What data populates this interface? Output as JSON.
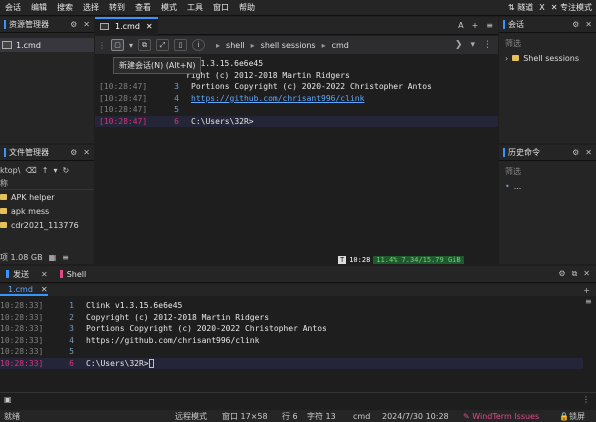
{
  "menu": [
    "会话",
    "编辑",
    "搜索",
    "选择",
    "转到",
    "查看",
    "模式",
    "工具",
    "窗口",
    "帮助"
  ],
  "menu_right": {
    "tunnel": "隧道",
    "x": "X",
    "focus": "专注模式"
  },
  "sessions_panel": {
    "title": "资源管理器",
    "item": "1.cmd"
  },
  "file_manager": {
    "title": "文件管理器",
    "path": "ktop\\",
    "col_name": "称",
    "files": [
      "APK helper",
      "apk mess",
      "cdr2021_113776"
    ],
    "status": "项 1.08 GB"
  },
  "main_tab": {
    "label": "1.cmd",
    "right": [
      "A",
      "+",
      "≡"
    ]
  },
  "breadcrumb": [
    "shell",
    "shell sessions",
    "cmd"
  ],
  "tooltip": "新建会话(N) (Alt+N)",
  "terminal_top": [
    {
      "ts": "",
      "ln": "",
      "text": "k v1.3.15.6e6e45",
      "hidden_ts": true
    },
    {
      "ts": "",
      "ln": "",
      "text": "right (c) 2012-2018 Martin Ridgers",
      "hidden_ts": true
    },
    {
      "ts": "[10:28:47]",
      "ln": "3",
      "text": "Portions Copyright (c) 2020-2022 Christopher Antos"
    },
    {
      "ts": "[10:28:47]",
      "ln": "4",
      "text": "https://github.com/chrisant996/clink",
      "link": true
    },
    {
      "ts": "[10:28:47]",
      "ln": "5",
      "text": ""
    },
    {
      "ts": "[10:28:47]",
      "ln": "6",
      "text": "C:\\Users\\32R>",
      "current": true
    }
  ],
  "main_status": {
    "time": "10:28",
    "cpu": "11.4%",
    "mem": "7.34/15.79 GiB"
  },
  "sessions_right": {
    "title": "会话",
    "item": "Shell sessions"
  },
  "history": {
    "title": "历史命令",
    "filter": "筛选",
    "item": "..."
  },
  "sessions_filter": "筛选",
  "bottom_tabs": {
    "send": "发送",
    "shell": "Shell"
  },
  "bottom_tab_label": "1.cmd",
  "terminal_bottom": [
    {
      "ts": "10:28:33]",
      "ln": "1",
      "text": "Clink v1.3.15.6e6e45"
    },
    {
      "ts": "10:28:33]",
      "ln": "2",
      "text": "Copyright (c) 2012-2018 Martin Ridgers"
    },
    {
      "ts": "10:28:33]",
      "ln": "3",
      "text": "Portions Copyright (c) 2020-2022 Christopher Antos"
    },
    {
      "ts": "10:28:33]",
      "ln": "4",
      "text": "https://github.com/chrisant996/clink"
    },
    {
      "ts": "10:28:33]",
      "ln": "5",
      "text": ""
    },
    {
      "ts": "10:28:33]",
      "ln": "6",
      "text": "C:\\Users\\32R>",
      "current": true
    }
  ],
  "statusbar": {
    "ready": "就绪",
    "mode": "远程模式",
    "window": "窗口 17×58",
    "row": "行 6",
    "chars": "字符 13",
    "shell": "cmd",
    "datetime": "2024/7/30 10:28",
    "issues": "WindTerm Issues",
    "lock": "锁屏"
  },
  "colors": {
    "accent": "#3794ff",
    "pink": "#e04a8a",
    "link": "#5fa8ff"
  }
}
